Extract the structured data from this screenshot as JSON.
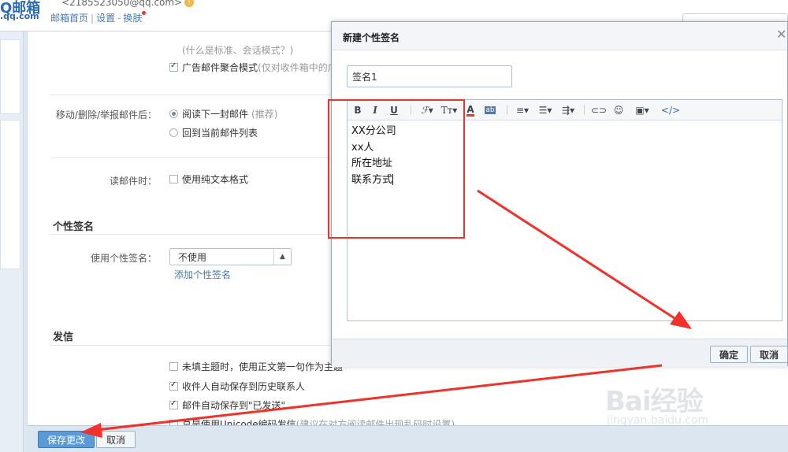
{
  "header": {
    "logo": "Q邮箱",
    "logo_domain": ".qq.com",
    "email": "<2185523050@qq.com>",
    "links": [
      "邮箱首页",
      "设置",
      "换肤"
    ]
  },
  "settings": {
    "std_mode_hint": "(什么是标准、会话模式？)",
    "ad_aggregate_label": "广告邮件聚合模式",
    "ad_aggregate_hint": "(仅对收件箱中的广",
    "after_action_label": "移动/删除/举报邮件后：",
    "after_action_opt1": "阅读下一封邮件",
    "after_action_opt1_hint": "(推荐)",
    "after_action_opt2": "回到当前邮件列表",
    "read_mail_label": "读邮件时：",
    "plain_text_label": "使用纯文本格式",
    "signature_section": "个性签名",
    "use_signature_label": "使用个性签名：",
    "signature_select_value": "不使用",
    "add_signature_link": "添加个性签名",
    "send_section": "发信",
    "send_opt1": "未填主题时，使用正文第一句作为主题",
    "send_opt2": "收件人自动保存到历史联系人",
    "send_opt3": "邮件自动保存到\"已发送\"",
    "send_opt4": "总是使用Unicode编码发信",
    "send_opt4_hint": "(建议在对方阅读邮件出现乱码时设置)"
  },
  "footer": {
    "save_label": "保存更改",
    "cancel_label": "取消"
  },
  "dialog": {
    "title": "新建个性签名",
    "name_value": "签名1",
    "toolbar": {
      "bold": "B",
      "italic": "I",
      "underline": "U",
      "code": "</>"
    },
    "body_lines": [
      "XX分公司",
      "xx人",
      "所在地址",
      "联系方式"
    ],
    "ok_label": "确定",
    "cancel_label": "取消"
  },
  "watermark": {
    "brand": "Bai经验",
    "url": "jingyan.baidu.com"
  },
  "colors": {
    "annotation_red": "#f0322b",
    "primary_button": "#5c9ad6",
    "link_blue": "#4a79b0"
  },
  "icons": [
    "warning-icon",
    "close-icon",
    "bold-icon",
    "italic-icon",
    "underline-icon",
    "font-family-icon",
    "font-size-icon",
    "font-color-icon",
    "background-color-icon",
    "align-icon",
    "unordered-list-icon",
    "indent-icon",
    "link-icon",
    "emoji-icon",
    "image-icon",
    "code-icon"
  ]
}
